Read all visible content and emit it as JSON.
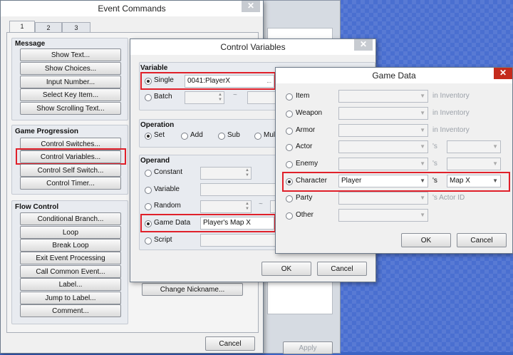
{
  "event_commands": {
    "title": "Event Commands",
    "close": "✕",
    "tabs": [
      "1",
      "2",
      "3"
    ],
    "sections": {
      "message": {
        "label": "Message",
        "buttons": [
          "Show Text...",
          "Show Choices...",
          "Input Number...",
          "Select Key Item...",
          "Show Scrolling Text..."
        ]
      },
      "game_progression": {
        "label": "Game Progression",
        "buttons": [
          "Control Switches...",
          "Control Variables...",
          "Control Self Switch...",
          "Control Timer..."
        ]
      },
      "flow_control": {
        "label": "Flow Control",
        "buttons": [
          "Conditional Branch...",
          "Loop",
          "Break Loop",
          "Exit Event Processing",
          "Call Common Event...",
          "Label...",
          "Jump to Label...",
          "Comment..."
        ]
      }
    },
    "change_nickname": "Change Nickname...",
    "cancel": "Cancel"
  },
  "background": {
    "apply": "Apply"
  },
  "control_variables": {
    "title": "Control Variables",
    "close": "✕",
    "variable": {
      "label": "Variable",
      "single": "Single",
      "single_value": "0041:PlayerX",
      "ellipsis": "...",
      "batch": "Batch",
      "tilde": "~"
    },
    "operation": {
      "label": "Operation",
      "options": [
        "Set",
        "Add",
        "Sub",
        "Mul"
      ]
    },
    "operand": {
      "label": "Operand",
      "options": [
        "Constant",
        "Variable",
        "Random",
        "Game Data",
        "Script"
      ],
      "random_tilde": "~",
      "game_data_value": "Player's Map X"
    },
    "ok": "OK",
    "cancel": "Cancel"
  },
  "game_data": {
    "title": "Game Data",
    "close": "✕",
    "rows": [
      {
        "label": "Item",
        "suffix": "in Inventory"
      },
      {
        "label": "Weapon",
        "suffix": "in Inventory"
      },
      {
        "label": "Armor",
        "suffix": "in Inventory"
      },
      {
        "label": "Actor",
        "suffix": "'s"
      },
      {
        "label": "Enemy",
        "suffix": "'s"
      },
      {
        "label": "Character",
        "value": "Player",
        "suffix": "'s",
        "value2": "Map X"
      },
      {
        "label": "Party",
        "suffix": "'s Actor ID"
      },
      {
        "label": "Other"
      }
    ],
    "ok": "OK",
    "cancel": "Cancel"
  },
  "colors": {
    "highlight": "#e0202a",
    "desktop": "#4a6fd0"
  }
}
